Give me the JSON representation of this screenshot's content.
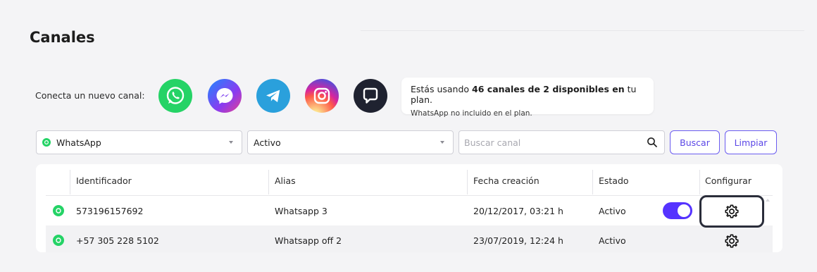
{
  "page": {
    "title": "Canales"
  },
  "connect": {
    "label": "Conecta un nuevo canal:",
    "channels": [
      {
        "name": "WhatsApp",
        "icon": "whatsapp-icon",
        "color": "#25d366"
      },
      {
        "name": "Messenger",
        "icon": "messenger-icon",
        "color": "#8a3bf0"
      },
      {
        "name": "Telegram",
        "icon": "telegram-icon",
        "color": "#2aa0dc"
      },
      {
        "name": "Instagram",
        "icon": "instagram-icon",
        "color": "#e1306c"
      },
      {
        "name": "Webchat",
        "icon": "chat-icon",
        "color": "#1f2230"
      }
    ]
  },
  "plan": {
    "prefix": "Estás usando ",
    "bold": "46 canales de 2 disponibles en",
    "suffix": " tu plan.",
    "note": "WhatsApp no incluido en el plan."
  },
  "filters": {
    "channel_value": "WhatsApp",
    "status_value": "Activo",
    "search_placeholder": "Buscar canal",
    "search_button": "Buscar",
    "clear_button": "Limpiar"
  },
  "table": {
    "headers": {
      "identifier": "Identificador",
      "alias": "Alias",
      "created": "Fecha creación",
      "status": "Estado",
      "configure": "Configurar"
    },
    "rows": [
      {
        "identifier": "573196157692",
        "alias": "Whatsapp 3",
        "created": "20/12/2017, 03:21 h",
        "status": "Activo",
        "toggle_on": true
      },
      {
        "identifier": "+57 305 228 5102",
        "alias": "Whatsapp off 2",
        "created": "23/07/2019, 12:24 h",
        "status": "Activo",
        "toggle_on": false
      }
    ]
  },
  "colors": {
    "accent": "#5533ff",
    "button_text": "#5a46e6",
    "whatsapp": "#25d366"
  }
}
